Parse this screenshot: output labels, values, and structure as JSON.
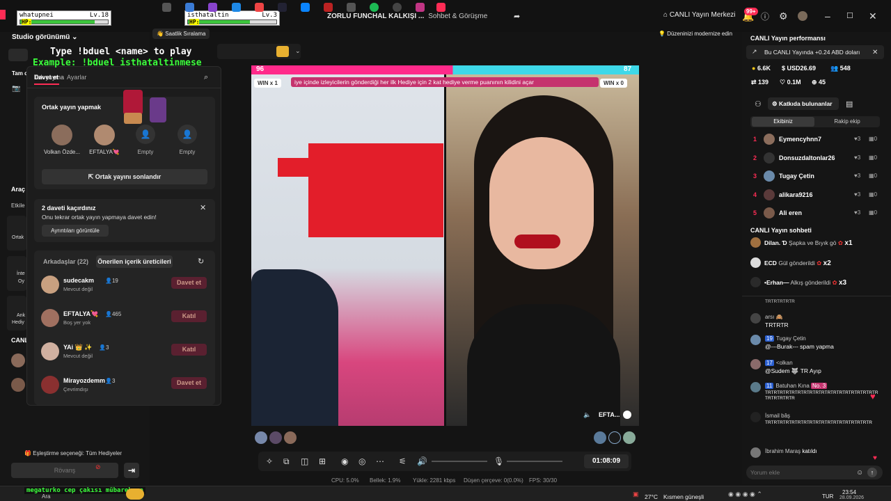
{
  "app": {
    "title": "ZORLU FUNCHAL KALKIŞI ...",
    "subtitle": "Sohbet & Görüşme",
    "live_center": "CANLI Yayın Merkezi",
    "notif_badge": "99+"
  },
  "overlay": {
    "p1_name": "whatupnei",
    "p1_level": "Lv.18",
    "p2_name": "isthataltin",
    "p2_level": "Lv.3",
    "hp": "HP:",
    "p1_hp": 0.85,
    "p2_hp": 0.7,
    "instr1": "Type !bduel <name> to play",
    "instr2": "Example: !bduel isthataltinmese",
    "corner_text": "megaturko cep çakısı mübarek ya"
  },
  "top": {
    "studio": "Studio görünümü",
    "hourly": "Saatlik Sıralama",
    "small_text": "Tak yayına",
    "modernize": "Düzeninizi modernize edin"
  },
  "invite": {
    "tab1": "Davet et",
    "tab2": "Ayarlar",
    "cohost_title": "Ortak yayın yapmak",
    "hosts": [
      {
        "name": "Volkan Özde..."
      },
      {
        "name": "EFTALYA💘"
      },
      {
        "name": "Empty"
      },
      {
        "name": "Empty"
      }
    ],
    "end_button": "Ortak yayını sonlandır",
    "missed_title": "2 daveti kaçırdınız",
    "missed_text": "Onu tekrar ortak yayın yapmaya davet edin!",
    "details_button": "Ayrıntıları görüntüle",
    "friends_tab": "Arkadaşlar (22)",
    "suggested_tab": "Önerilen içerik üreticileri",
    "friends": [
      {
        "name": "sudecakm",
        "count": "19",
        "status": "Mevcut değil",
        "action": "Davet et"
      },
      {
        "name": "EFTALYA💘",
        "count": "465",
        "status": "Boş yer yok",
        "action": "Katıl"
      },
      {
        "name": "YAi 👑 ✨",
        "count": "3",
        "status": "Mevcut değil",
        "action": "Katıl"
      },
      {
        "name": "Mirayozdemm",
        "count": "3",
        "status": "Çevrimdışı",
        "action": "Davet et"
      }
    ]
  },
  "left": {
    "tam": "Tam c",
    "arac": "Araç",
    "etkile": "Etkile",
    "ortak": "Ortak",
    "inte": "İnte",
    "oy": "Oy",
    "ank": "Ank",
    "hedi": "Hediy",
    "canl": "CANL",
    "match": "Eşleştirme seçeneği: Tüm Hediyeler",
    "rematch": "Rövanş"
  },
  "battle": {
    "score_left": "96",
    "score_right": "87",
    "win_left": "WIN x 1",
    "win_right": "WIN x 0",
    "banner": "iye içinde izleyicilerin gönderdiği her ilk Hediye için 2 kat hediye verme puanının kilidini açar",
    "guest_name": "EFTA..."
  },
  "controls": {
    "timer": "01:08:09"
  },
  "stats": {
    "cpu": "CPU: 5.0%",
    "mem": "Bellek: 1.9%",
    "upload": "Yükle: 2281 kbps",
    "drop": "Düşen çerçeve: 0(0.0%)",
    "fps": "FPS: 30/30"
  },
  "perf": {
    "title": "CANLI Yayın performansı",
    "toast": "Bu CANLI Yayında +0.24 ABD doları",
    "coins": "6.6K",
    "usd": "USD26.69",
    "viewers": "548",
    "shares": "139",
    "likes": "0.1M",
    "new": "45"
  },
  "contrib": {
    "title": "Katkıda bulunanlar",
    "tab1": "Ekibiniz",
    "tab2": "Rakip ekip",
    "rows": [
      {
        "rank": "1",
        "name": "Eymencyhnn7",
        "hearts": "3",
        "gifts": "0"
      },
      {
        "rank": "2",
        "name": "Donsuzdaltonlar26",
        "hearts": "3",
        "gifts": "0"
      },
      {
        "rank": "3",
        "name": "Tugay Çetin",
        "hearts": "3",
        "gifts": "0"
      },
      {
        "rank": "4",
        "name": "alikara9216",
        "hearts": "3",
        "gifts": "0"
      },
      {
        "rank": "5",
        "name": "Ali eren",
        "hearts": "3",
        "gifts": "0"
      }
    ]
  },
  "chat": {
    "title": "CANLI Yayın sohbeti",
    "gifts": [
      {
        "user": "Dilan. Ɗ",
        "text": "Şapka ve Bıyık gö",
        "mult": "x1"
      },
      {
        "user": "ECD",
        "text": "Gül gönderildi",
        "mult": "x2"
      },
      {
        "user": "•Erhan—",
        "text": "Alkış gönderildi",
        "mult": "x3"
      }
    ],
    "messages": [
      {
        "user": "",
        "text": "TRTRTRTRTR"
      },
      {
        "user": "arsı 🙈",
        "text": "TRTRTR"
      },
      {
        "user": "Tugay Çetin",
        "badge": "19",
        "text": "@---Burak--- spam yapma"
      },
      {
        "user": "<olkan",
        "badge": "17",
        "text": "@Sudem 🐺 TR Ayıp"
      },
      {
        "user": "Batuhan Kına",
        "badge": "11",
        "extra": "No. 3",
        "text": "TRTRTRTRTRTRTRTRTRTRTRTRTRTRTRTRTRTRTRTRTRTRTRTR"
      },
      {
        "user": "İsmail bâş",
        "text": "TRTRTRTRTRTRTRTRTRTRTRTRTRTRTRTRTRTR"
      },
      {
        "user": "İbrahim Maraş",
        "text": "katıldı"
      }
    ],
    "input_placeholder": "Yorum ekle"
  },
  "taskbar": {
    "search": "Ara",
    "weather": "27°C",
    "weather_text": "Kısmen güneşli",
    "lang": "TUR",
    "time": "23:54",
    "date": "28.09.2026"
  }
}
